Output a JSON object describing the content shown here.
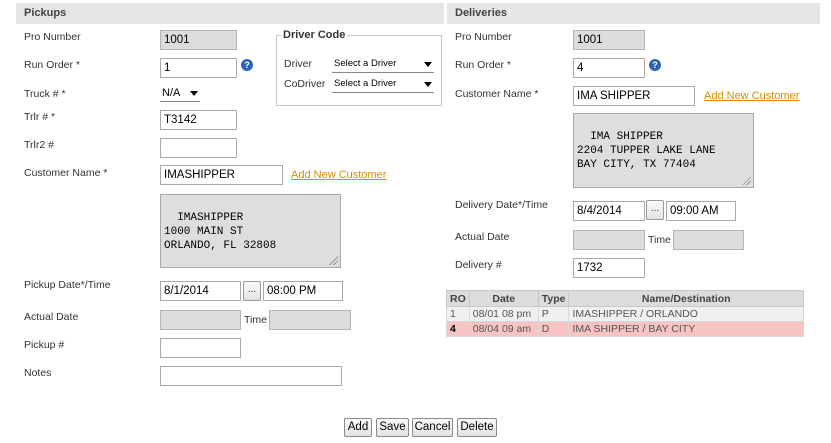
{
  "pickups": {
    "header": "Pickups",
    "pro_number_label": "Pro Number",
    "pro_number": "1001",
    "run_order_label": "Run Order *",
    "run_order": "1",
    "truck_label": "Truck # *",
    "truck": "N/A",
    "trlr_label": "Trlr # *",
    "trlr": "T3142",
    "trlr2_label": "Trlr2 #",
    "trlr2": "",
    "customer_label": "Customer Name *",
    "customer": "IMASHIPPER",
    "add_customer": "Add New Customer",
    "address": "IMASHIPPER\n1000 MAIN ST\nORLANDO, FL 32808",
    "date_label": "Pickup Date*/Time",
    "date": "8/1/2014",
    "time": "08:00 PM",
    "actual_label": "Actual Date",
    "actual_date": "",
    "time_label": "Time",
    "actual_time": "",
    "number_label": "Pickup #",
    "number": "",
    "notes_label": "Notes",
    "notes": ""
  },
  "driver_code": {
    "legend": "Driver Code",
    "driver_label": "Driver",
    "driver_value": "Select a Driver",
    "codriver_label": "CoDriver",
    "codriver_value": "Select a Driver"
  },
  "deliveries": {
    "header": "Deliveries",
    "pro_number_label": "Pro Number",
    "pro_number": "1001",
    "run_order_label": "Run Order *",
    "run_order": "4",
    "customer_label": "Customer Name *",
    "customer": "IMA SHIPPER",
    "add_customer": "Add New Customer",
    "address": "IMA SHIPPER\n2204 TUPPER LAKE LANE\nBAY CITY, TX 77404",
    "date_label": "Delivery Date*/Time",
    "date": "8/4/2014",
    "time": "09:00 AM",
    "actual_label": "Actual Date",
    "actual_date": "",
    "time_label": "Time",
    "actual_time": "",
    "number_label": "Delivery #",
    "number": "1732"
  },
  "stops_table": {
    "headers": [
      "RO",
      "Date",
      "Type",
      "Name/Destination"
    ],
    "rows": [
      [
        "1",
        "08/01 08 pm",
        "P",
        "IMASHIPPER / ORLANDO"
      ],
      [
        "4",
        "08/04 09 am",
        "D",
        "IMA SHIPPER / BAY CITY"
      ]
    ]
  },
  "help_glyph": "?",
  "ellipsis_glyph": "...",
  "actions": {
    "add": "Add",
    "save": "Save",
    "cancel": "Cancel",
    "delete": "Delete"
  },
  "colors": {
    "link": "#d98c00",
    "selected_row": "#f7c3c3",
    "header_bg": "#e6e6e6",
    "help_icon": "#2d63b5"
  },
  "icons": [
    "help-icon",
    "dropdown-caret-icon",
    "resize-grip-icon",
    "date-picker-icon"
  ]
}
